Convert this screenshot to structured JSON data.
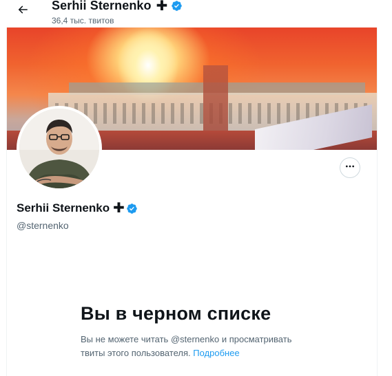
{
  "header": {
    "title": "Serhii Sternenko",
    "title_suffix": "✚",
    "tweet_count": "36,4 тыс. твитов"
  },
  "profile": {
    "name": "Serhii Sternenko",
    "name_suffix": "✚",
    "handle": "@sternenko"
  },
  "blocked": {
    "title": "Вы в черном списке",
    "message": "Вы не можете читать @sternenko и просматривать твиты этого пользователя.",
    "learn_more": "Подробнее"
  },
  "colors": {
    "verified": "#1d9bf0",
    "link": "#1d9bf0",
    "secondary_text": "#536471"
  },
  "icons": {
    "back": "arrow-left-icon",
    "verified": "verified-badge-icon",
    "more": "more-horizontal-icon"
  }
}
